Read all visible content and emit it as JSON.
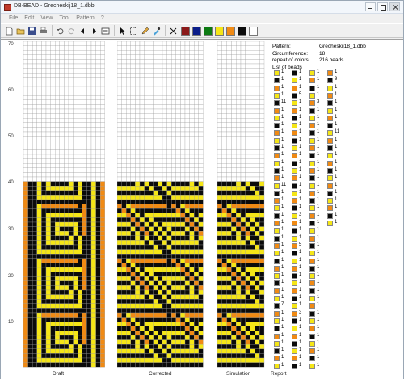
{
  "window": {
    "title": "DB-BEAD - Grecheskij18_1.dbb"
  },
  "menu": [
    "File",
    "Edit",
    "View",
    "Tool",
    "Pattern",
    "?"
  ],
  "toolbar": {
    "tools": [
      "new-icon",
      "open-icon",
      "save-icon",
      "print-icon",
      "undo-icon",
      "redo-icon",
      "arrow-left-icon",
      "arrow-right-icon",
      "preview-icon",
      "pointer-icon",
      "select-rect-icon",
      "pencil-icon",
      "pipette-icon",
      "clear-icon"
    ],
    "palette": [
      "#8b1a1a",
      "#0b1d8a",
      "#0c7a12",
      "#f5e617",
      "#f08a14",
      "#0b0b0b",
      "#ffffff"
    ]
  },
  "ruler": {
    "labels": [
      "70",
      "60",
      "50",
      "40",
      "30",
      "20",
      "10"
    ]
  },
  "views": {
    "draft_label": "Draft",
    "corrected_label": "Corrected",
    "simulation_label": "Simulation",
    "report_label": "Report"
  },
  "info": {
    "pattern_key": "Pattern:",
    "pattern_val": "Grecheskij18_1.dbb",
    "circ_key": "Circumference:",
    "circ_val": "18",
    "repeat_key": "repeat of colors:",
    "repeat_val": "216 beads",
    "list_label": "List of beads"
  },
  "bead_list": {
    "col1": [
      [
        "y",
        "1"
      ],
      [
        "k",
        "1"
      ],
      [
        "o",
        "1"
      ],
      [
        "y",
        "1"
      ],
      [
        "k",
        "11"
      ],
      [
        "o",
        "1"
      ],
      [
        "y",
        "1"
      ],
      [
        "k",
        "1"
      ],
      [
        "o",
        "1"
      ],
      [
        "y",
        "1"
      ],
      [
        "k",
        "1"
      ],
      [
        "o",
        "1"
      ],
      [
        "y",
        "1"
      ],
      [
        "k",
        "1"
      ],
      [
        "o",
        "1"
      ],
      [
        "y",
        "11"
      ],
      [
        "k",
        "1"
      ],
      [
        "o",
        "1"
      ],
      [
        "y",
        "1"
      ],
      [
        "k",
        "1"
      ],
      [
        "o",
        "1"
      ],
      [
        "y",
        "1"
      ],
      [
        "k",
        "1"
      ],
      [
        "o",
        "1"
      ],
      [
        "y",
        "1"
      ],
      [
        "k",
        "1"
      ],
      [
        "o",
        "1"
      ],
      [
        "y",
        "1"
      ],
      [
        "k",
        "1"
      ],
      [
        "o",
        "1"
      ],
      [
        "y",
        "1"
      ],
      [
        "k",
        "7"
      ],
      [
        "o",
        "1"
      ],
      [
        "y",
        "1"
      ],
      [
        "k",
        "1"
      ],
      [
        "o",
        "1"
      ],
      [
        "y",
        "1"
      ],
      [
        "k",
        "1"
      ],
      [
        "o",
        "1"
      ],
      [
        "y",
        "1"
      ]
    ],
    "col2": [
      [
        "k",
        "1"
      ],
      [
        "y",
        "1"
      ],
      [
        "o",
        "1"
      ],
      [
        "k",
        "5"
      ],
      [
        "y",
        "1"
      ],
      [
        "o",
        "1"
      ],
      [
        "k",
        "1"
      ],
      [
        "y",
        "1"
      ],
      [
        "o",
        "1"
      ],
      [
        "k",
        "1"
      ],
      [
        "y",
        "1"
      ],
      [
        "o",
        "1"
      ],
      [
        "k",
        "1"
      ],
      [
        "y",
        "1"
      ],
      [
        "o",
        "1"
      ],
      [
        "k",
        "1"
      ],
      [
        "y",
        "1"
      ],
      [
        "o",
        "1"
      ],
      [
        "k",
        "1"
      ],
      [
        "y",
        "3"
      ],
      [
        "o",
        "1"
      ],
      [
        "k",
        "1"
      ],
      [
        "y",
        "1"
      ],
      [
        "o",
        "5"
      ],
      [
        "k",
        "1"
      ],
      [
        "y",
        "1"
      ],
      [
        "o",
        "1"
      ],
      [
        "k",
        "1"
      ],
      [
        "y",
        "1"
      ],
      [
        "o",
        "1"
      ],
      [
        "k",
        "1"
      ],
      [
        "y",
        "1"
      ],
      [
        "o",
        "3"
      ],
      [
        "k",
        "1"
      ],
      [
        "y",
        "1"
      ],
      [
        "o",
        "1"
      ],
      [
        "k",
        "1"
      ],
      [
        "y",
        "1"
      ],
      [
        "o",
        "1"
      ],
      [
        "k",
        "1"
      ]
    ],
    "col3": [
      [
        "y",
        "1"
      ],
      [
        "o",
        "1"
      ],
      [
        "k",
        "1"
      ],
      [
        "y",
        "1"
      ],
      [
        "o",
        "3"
      ],
      [
        "k",
        "1"
      ],
      [
        "y",
        "1"
      ],
      [
        "o",
        "1"
      ],
      [
        "k",
        "1"
      ],
      [
        "y",
        "1"
      ],
      [
        "o",
        "1"
      ],
      [
        "k",
        "1"
      ],
      [
        "y",
        "1"
      ],
      [
        "o",
        "1"
      ],
      [
        "k",
        "1"
      ],
      [
        "y",
        "1"
      ],
      [
        "o",
        "1"
      ],
      [
        "k",
        "1"
      ],
      [
        "y",
        "1"
      ],
      [
        "o",
        "1"
      ],
      [
        "k",
        "1"
      ],
      [
        "y",
        "1"
      ],
      [
        "o",
        "1"
      ],
      [
        "k",
        "1"
      ],
      [
        "y",
        "1"
      ],
      [
        "o",
        "1"
      ],
      [
        "k",
        "1"
      ],
      [
        "y",
        "1"
      ],
      [
        "o",
        "1"
      ],
      [
        "k",
        "1"
      ],
      [
        "y",
        "1"
      ],
      [
        "o",
        "1"
      ],
      [
        "k",
        "1"
      ],
      [
        "y",
        "1"
      ],
      [
        "o",
        "1"
      ],
      [
        "k",
        "1"
      ],
      [
        "y",
        "1"
      ],
      [
        "o",
        "1"
      ],
      [
        "k",
        "1"
      ],
      [
        "y",
        "1"
      ]
    ],
    "col4": [
      [
        "o",
        "1"
      ],
      [
        "k",
        "9"
      ],
      [
        "y",
        "1"
      ],
      [
        "o",
        "1"
      ],
      [
        "k",
        "1"
      ],
      [
        "y",
        "1"
      ],
      [
        "o",
        "1"
      ],
      [
        "k",
        "1"
      ],
      [
        "y",
        "11"
      ],
      [
        "o",
        "1"
      ],
      [
        "k",
        "1"
      ],
      [
        "y",
        "1"
      ],
      [
        "o",
        "1"
      ],
      [
        "k",
        "1"
      ],
      [
        "y",
        "1"
      ],
      [
        "o",
        "1"
      ],
      [
        "k",
        "1"
      ],
      [
        "y",
        "1"
      ],
      [
        "o",
        "1"
      ],
      [
        "k",
        "1"
      ],
      [
        "y",
        "1"
      ]
    ]
  }
}
